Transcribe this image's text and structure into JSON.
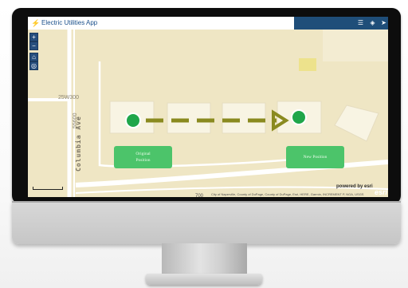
{
  "app": {
    "title": "Electric Utilities App",
    "logo_icon": "utility-logo-icon"
  },
  "toolbar": {
    "icons": [
      "list-icon",
      "layers-icon",
      "location-icon"
    ]
  },
  "nav": {
    "zoom_in": "+",
    "zoom_out": "−",
    "home_icon": "home-icon",
    "locate_icon": "locate-icon"
  },
  "map": {
    "street_label": "25W300",
    "road_name": "Columbia Ave",
    "address_number": "55600",
    "bottom_label": "700",
    "original_position_label": "Original\nPosition",
    "new_position_label": "New Position",
    "attribution": "City of Naperville, County of DuPage, County of DuPage, Esri, HERE, Garmin, INCREMENT P, NGA, USGS",
    "powered_by": "powered by esri",
    "esri_logo": "esri",
    "colors": {
      "map_background": "#efe6c4",
      "building": "#f8f4e3",
      "marker": "#1fa64a",
      "arrow": "#8a8a1f",
      "position_box": "#4cc46a",
      "header_bar": "#1f4e79"
    }
  }
}
